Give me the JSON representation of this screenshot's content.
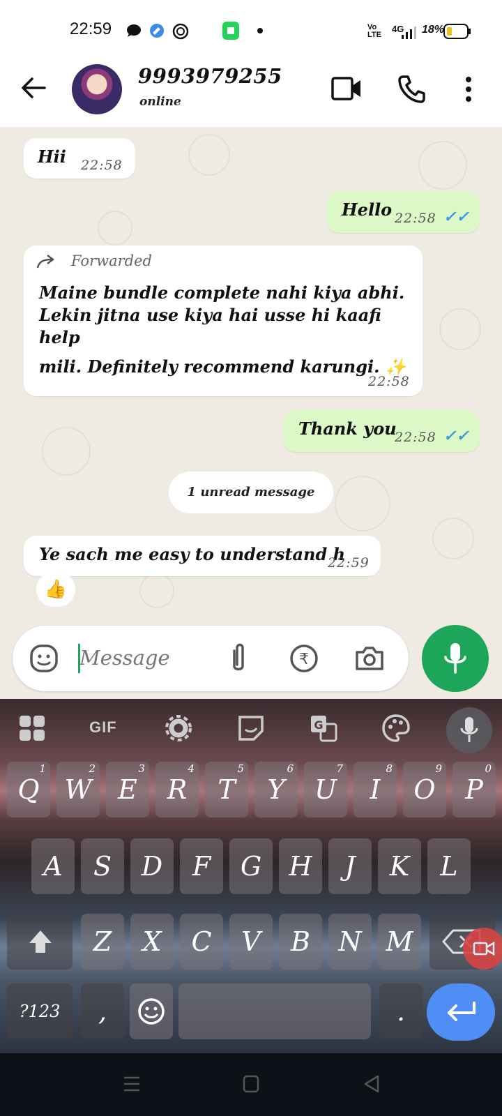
{
  "status_bar": {
    "time": "22:59",
    "network": "4G",
    "volte": "Vo LTE",
    "battery": "18%"
  },
  "header": {
    "contact_name": "9993979255",
    "contact_status": "online",
    "icons": [
      "back-arrow-icon",
      "video-call-icon",
      "voice-call-icon",
      "more-options-icon"
    ]
  },
  "messages": [
    {
      "direction": "in",
      "text": "Hii",
      "time": "22:58"
    },
    {
      "direction": "out",
      "text": "Hello",
      "time": "22:58",
      "read": true
    },
    {
      "direction": "in",
      "forwarded_label": "Forwarded",
      "lines": [
        "Maine bundle complete nahi kiya abhi.",
        "Lekin jitna use kiya hai usse hi kaafi help",
        "mili.  Definitely recommend karungi. ✨"
      ],
      "time": "22:58"
    },
    {
      "direction": "out",
      "text": "Thank you",
      "time": "22:58",
      "read": true
    },
    {
      "direction": "in",
      "text": "Ye sach me easy to understand h",
      "time": "22:59",
      "reaction": "👍"
    }
  ],
  "unread_divider": "1 unread message",
  "composer": {
    "placeholder": "Message"
  },
  "keyboard": {
    "toolbar": [
      "apps-grid-icon",
      "GIF",
      "settings-gear-icon",
      "sticker-icon",
      "translate-icon",
      "theme-palette-icon",
      "voice-input-icon"
    ],
    "gif_label": "GIF",
    "row1": [
      {
        "k": "Q",
        "n": "1"
      },
      {
        "k": "W",
        "n": "2"
      },
      {
        "k": "E",
        "n": "3"
      },
      {
        "k": "R",
        "n": "4"
      },
      {
        "k": "T",
        "n": "5"
      },
      {
        "k": "Y",
        "n": "6"
      },
      {
        "k": "U",
        "n": "7"
      },
      {
        "k": "I",
        "n": "8"
      },
      {
        "k": "O",
        "n": "9"
      },
      {
        "k": "P",
        "n": "0"
      }
    ],
    "row2": [
      "A",
      "S",
      "D",
      "F",
      "G",
      "H",
      "J",
      "K",
      "L"
    ],
    "row3": [
      "Z",
      "X",
      "C",
      "V",
      "B",
      "N",
      "M"
    ],
    "symbols_label": "?123",
    "comma": ",",
    "period": "."
  },
  "colors": {
    "chat_bg": "#efeae2",
    "outgoing_bubble": "#dcf8c6",
    "read_ticks": "#3b9be0",
    "mic_button": "#1da65a",
    "enter_key": "#4f8ef5"
  }
}
